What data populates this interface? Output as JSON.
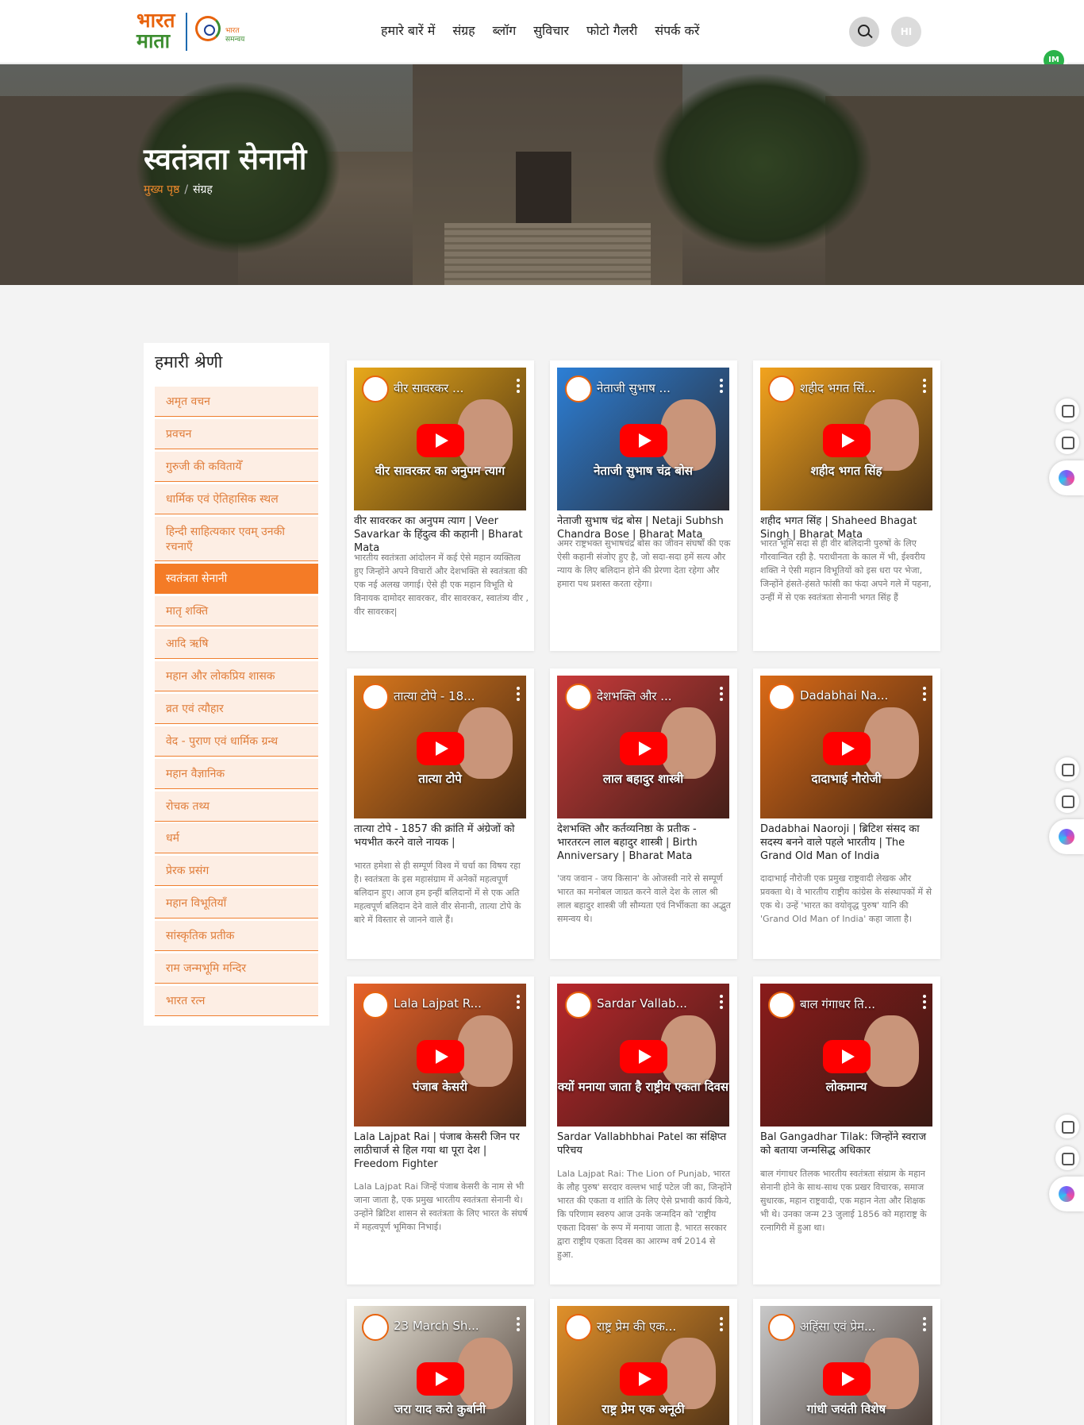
{
  "header": {
    "logo_line1": "भारत",
    "logo_line2": "माता",
    "logo_sub1": "भारत",
    "logo_sub2": "समन्वय",
    "nav": [
      "हमारे बारें में",
      "संग्रह",
      "ब्लॉग",
      "सुविचार",
      "फोटो गैलरी",
      "संपर्क करें"
    ],
    "avatar_text": "HI",
    "extension_badge": "IM"
  },
  "hero": {
    "title": "स्वतंत्रता सेनानी",
    "breadcrumb": {
      "home": "मुख्य पृष्ठ",
      "separator": "/",
      "current": "संग्रह"
    }
  },
  "sidebar": {
    "heading": "हमारी श्रेणी",
    "categories": [
      "अमृत वचन",
      "प्रवचन",
      "गुरुजी की कवितायेँ",
      "धार्मिक एवं ऐतिहासिक स्थल",
      "हिन्दी साहित्यकार एवम् उनकी रचनाएँ",
      "स्वतंत्रता सेनानी",
      "मातृ शक्ति",
      "आदि ऋषि",
      "महान और लोकप्रिय शासक",
      "व्रत एवं त्यौहार",
      "वेद - पुराण एवं धार्मिक ग्रन्थ",
      "महान वैज्ञानिक",
      "रोचक तथ्य",
      "धर्म",
      "प्रेरक प्रसंग",
      "महान विभूतियाँ",
      "सांस्कृतिक प्रतीक",
      "राम जन्मभूमि मन्दिर",
      "भारत रत्न"
    ],
    "active_index": 5
  },
  "cards": [
    {
      "video_title": "वीर सावरकर ...",
      "banner": "वीर सावरकर का अनुपम त्याग",
      "title": "वीर सावरकर का अनुपम त्याग | Veer Savarkar के हिंदुत्व की कहानी | Bharat Mata",
      "desc": "भारतीय स्वतंत्रता आंदोलन में कई ऐसे महान व्यक्तित्व हुए जिन्होंने अपने विचारों और देशभक्ति से स्वतंत्रता की एक नई अलख जगाई। ऐसे ही एक महान विभूति थे विनायक दामोदर सावरकर, वीर सावरकर, स्वातंत्र्य वीर , वीर सावरकर|",
      "color": "#e8a81a"
    },
    {
      "video_title": "नेताजी सुभाष ...",
      "banner": "नेताजी सुभाष चंद्र बोस",
      "title": "नेताजी सुभाष चंद्र बोस | Netaji Subhsh Chandra Bose | Bharat Mata",
      "desc": "अमर राष्ट्रभक्त सुभाषचंद्र बोस का जीवन संघर्षों की एक ऐसी कहानी संजोए हुए है, जो सदा-सदा हमें सत्य और न्याय के लिए बलिदान होने की प्रेरणा देता रहेगा और हमारा पथ प्रशस्त करता रहेगा।",
      "color": "#2c7fd6"
    },
    {
      "video_title": "शहीद भगत सिं...",
      "banner": "शहीद भगत सिंह",
      "title": "शहीद भगत सिंह | Shaheed Bhagat Singh | Bharat Mata",
      "desc": "भारत भूमि सदा से ही वीर बलिदानी पुरुषों के लिए गौरवान्वित रही है. पराधीनता के काल में भी, ईश्वरीय शक्ति ने ऐसी महान विभूतियों को इस धरा पर भेजा, जिन्होंने हंसते-हंसते फांसी का फंदा अपने गले में पहना, उन्हीं में से एक स्वतंत्रता सेनानी भगत सिंह हैं",
      "color": "#f2a31e"
    },
    {
      "video_title": "तात्या टोपे - 18...",
      "banner": "तात्या टोपे",
      "title": "तात्या टोपे - 1857 की क्रांति में अंग्रेजों को भयभीत करने वाले नायक |",
      "desc": "भारत हमेशा से ही सम्पूर्ण विश्व में चर्चा का विषय रहा है। स्वतंत्रता के इस महासंग्राम में अनेकों महत्वपूर्ण बलिदान हुए। आज हम इन्हीं बलिदानों में से एक अति महत्वपूर्ण बलिदान देने वाले वीर सेनानी, तात्या टोपे के बारे में विस्तार से जानने वाले हैं।",
      "color": "#d9771c"
    },
    {
      "video_title": "देशभक्ति और ...",
      "banner": "लाल बहादुर शास्त्री",
      "title": "देशभक्ति और कर्तव्यनिष्ठा के प्रतीक - भारतरत्न लाल बहादुर शास्त्री | Birth Anniversary | Bharat Mata",
      "desc": "'जय जवान - जय किसान' के ओजस्वी नारे से सम्पूर्ण भारत का मनोबल जाग्रत करने वाले देश के लाल श्री लाल बहादुर शास्त्री जी सौम्यता एवं निर्भीकता का अद्भुत समन्वय थे।",
      "color": "#c83a3a"
    },
    {
      "video_title": "Dadabhai Na...",
      "banner": "दादाभाई नौरोजी",
      "title": "Dadabhai Naoroji | ब्रिटिश संसद का सदस्य बनने वाले पहले भारतीय | The Grand Old Man of India",
      "desc": "दादाभाई नौरोजी एक प्रमुख राष्ट्रवादी लेखक और प्रवक्ता थे। वे भारतीय राष्ट्रीय कांग्रेस के संस्थापकों में से एक थे। उन्हें 'भारत का वयोवृद्ध पुरुष' यानि की 'Grand Old Man of India' कहा जाता है।",
      "color": "#d96a17"
    },
    {
      "video_title": "Lala Lajpat R...",
      "banner": "पंजाब केसरी",
      "title": "Lala Lajpat Rai | पंजाब केसरी जिन पर लाठीचार्ज से हिल गया था पूरा देश | Freedom Fighter",
      "desc": "Lala Lajpat Rai जिन्हें पंजाब केसरी के नाम से भी जाना जाता है, एक प्रमुख भारतीय स्वतंत्रता सेनानी थे। उन्होंने ब्रिटिश शासन से स्वतंत्रता के लिए भारत के संघर्ष में महत्वपूर्ण भूमिका निभाई।",
      "color": "#e8632a"
    },
    {
      "video_title": "Sardar Vallab...",
      "banner": "क्यों मनाया जाता है राष्ट्रीय एकता दिवस",
      "title": "Sardar Vallabhbhai Patel का संक्षिप्त परिचय",
      "desc": "Lala Lajpat Rai: The Lion of Punjab, भारत के लौह पुरुष' सरदार वल्लभ भाई पटेल जी का, जिन्होंने भारत की एकता व शांति के लिए ऐसे प्रभावी कार्य किये, कि परिणाम स्वरुप आज उनके जन्मदिन को 'राष्ट्रीय एकता दिवस' के रूप में मनाया जाता है. भारत सरकार द्वारा राष्ट्रीय एकता दिवस का आरम्भ वर्ष 2014 से हुआ.",
      "color": "#b8272c"
    },
    {
      "video_title": "बाल गंगाधर ति...",
      "banner": "लोकमान्य",
      "title": "Bal Gangadhar Tilak: जिन्होंने स्वराज को बताया जन्मसिद्ध अधिकार",
      "desc": "बाल गंगाधर तिलक भारतीय स्वतंत्रता संग्राम के महान सेनानी होने के साथ-साथ एक प्रखर विचारक, समाज सुधारक, महान राष्ट्रवादी, एक महान नेता और शिक्षक भी थे। उनका जन्म 23 जुलाई 1856 को महाराष्ट्र के रत्नागिरी में हुआ था।",
      "color": "#8a1b1b"
    },
    {
      "video_title": "23 March Sh...",
      "banner": "जरा याद करो कुर्बानी",
      "title": "",
      "desc": "",
      "color": "#e9e4d8"
    },
    {
      "video_title": "राष्ट्र प्रेम की एक...",
      "banner": "राष्ट्र प्रेम एक अनूठी",
      "title": "",
      "desc": "",
      "color": "#e0902a"
    },
    {
      "video_title": "अहिंसा एवं प्रेम...",
      "banner": "गांधी जयंती विशेष",
      "title": "",
      "desc": "",
      "color": "#c8c8c8"
    }
  ]
}
